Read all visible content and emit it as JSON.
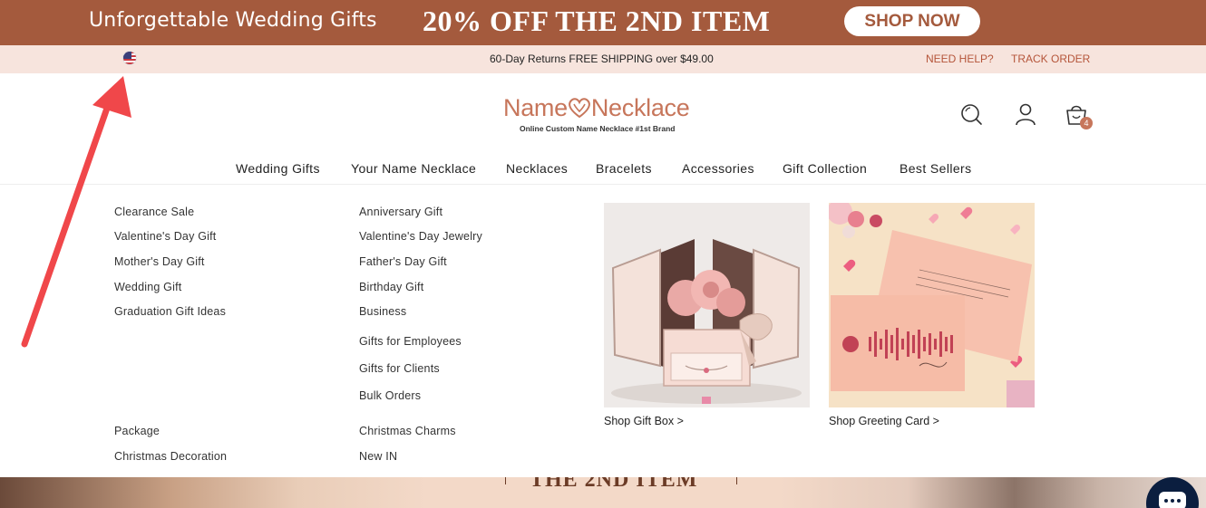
{
  "promo_banner": {
    "left_text": "Unforgettable Wedding Gifts",
    "center_text": "20% OFF THE 2ND ITEM",
    "button_label": "SHOP NOW"
  },
  "utility_bar": {
    "shipping_text": "60-Day Returns FREE SHIPPING over $49.00",
    "need_help": "NEED HELP?",
    "track_order": "TRACK ORDER",
    "flag_icon": "us-flag-icon"
  },
  "header": {
    "logo_name": "Name",
    "logo_name2": "Necklace",
    "logo_tagline": "Online Custom Name Necklace #1st Brand",
    "cart_count": "4",
    "icons": [
      "search-icon",
      "account-icon",
      "cart-icon"
    ]
  },
  "nav": {
    "items": [
      "Wedding Gifts",
      "Your Name Necklace",
      "Necklaces",
      "Bracelets",
      "Accessories",
      "Gift Collection",
      "Best Sellers"
    ]
  },
  "mega_menu": {
    "col1": [
      "Clearance Sale",
      "Valentine's Day Gift",
      "Mother's Day Gift",
      "Wedding Gift",
      "Graduation Gift Ideas"
    ],
    "col1_bottom": [
      "Package",
      "Christmas Decoration"
    ],
    "col2": [
      "Anniversary Gift",
      "Valentine's Day Jewelry",
      "Father's Day Gift",
      "Birthday Gift",
      "Business"
    ],
    "col2_sub": [
      "Gifts for Employees",
      "Gifts for Clients",
      "Bulk Orders"
    ],
    "col2_bottom": [
      "Christmas Charms",
      "New IN"
    ],
    "promos": [
      {
        "caption": "Shop Gift Box >",
        "image": "gift-box-image"
      },
      {
        "caption": "Shop Greeting Card >",
        "image": "greeting-card-image"
      }
    ]
  },
  "hero": {
    "text": "THE 2ND ITEM"
  },
  "colors": {
    "brand": "#a45a3d",
    "accent": "#c7765b",
    "utility_bg": "#f7e4dd",
    "arrow": "#f0474a"
  }
}
